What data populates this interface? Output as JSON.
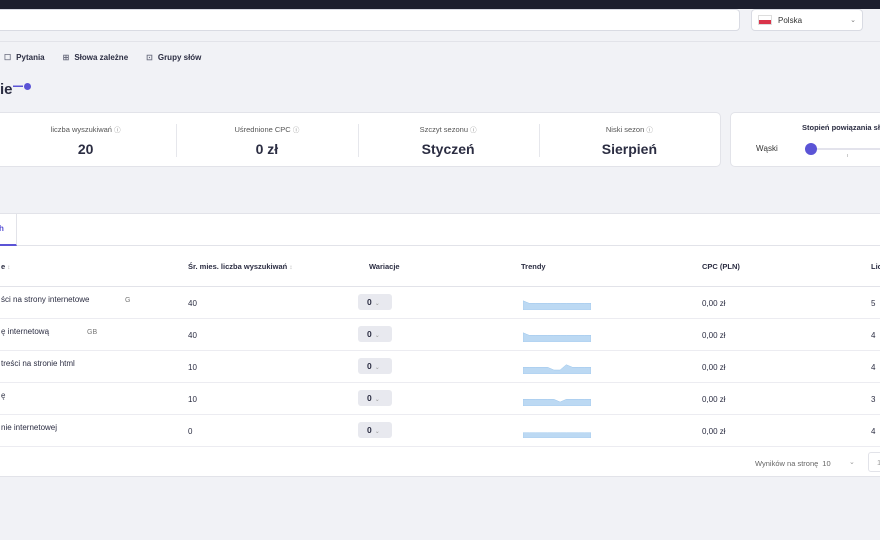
{
  "country": {
    "label": "Polska",
    "flag": "poland-flag"
  },
  "nav": [
    {
      "icon": "question-icon",
      "label": "Pytania"
    },
    {
      "icon": "keywords-icon",
      "label": "Słowa zależne"
    },
    {
      "icon": "groups-icon",
      "label": "Grupy słów"
    }
  ],
  "title": "ie",
  "stats": [
    {
      "label": "liczba wyszukiwań",
      "value": "20"
    },
    {
      "label": "Uśrednione CPC",
      "value": "0 zł"
    },
    {
      "label": "Szczyt sezonu",
      "value": "Styczeń"
    },
    {
      "label": "Niski sezon",
      "value": "Sierpień"
    }
  ],
  "relation": {
    "title": "Stopień powiązania sł",
    "narrow_label": "Wąski",
    "level": 0.0
  },
  "table": {
    "active_tab": "h",
    "columns": {
      "keyword": "e",
      "volume": "Śr. mies. liczba wyszukiwań",
      "variation": "Wariacje",
      "trends": "Trendy",
      "cpc": "CPC (PLN)",
      "last": "Lic"
    },
    "rows": [
      {
        "keyword": "ści na strony internetowe",
        "tag": "G",
        "volume": "40",
        "variation": "0",
        "trend": [
          4,
          2,
          2,
          2,
          2,
          2,
          2,
          2,
          2,
          2,
          2,
          2
        ],
        "cpc": "0,00 zł",
        "last": "5"
      },
      {
        "keyword": "ę internetową",
        "tag": "GB",
        "volume": "40",
        "variation": "0",
        "trend": [
          4,
          2,
          2,
          2,
          2,
          2,
          2,
          2,
          2,
          2,
          2,
          2
        ],
        "cpc": "0,00 zł",
        "last": "4"
      },
      {
        "keyword": "treści na stronie html",
        "tag": "",
        "volume": "10",
        "variation": "0",
        "trend": [
          2,
          2,
          2,
          2,
          2,
          0,
          0,
          4,
          2,
          2,
          2,
          2
        ],
        "cpc": "0,00 zł",
        "last": "4"
      },
      {
        "keyword": "ę",
        "tag": "",
        "volume": "10",
        "variation": "0",
        "trend": [
          2,
          2,
          2,
          2,
          2,
          2,
          0,
          2,
          2,
          2,
          2,
          2
        ],
        "cpc": "0,00 zł",
        "last": "3"
      },
      {
        "keyword": "nie internetowej",
        "tag": "",
        "volume": "0",
        "variation": "0",
        "trend": [
          1,
          1,
          1,
          1,
          1,
          1,
          1,
          1,
          1,
          1,
          1,
          1
        ],
        "cpc": "0,00 zł",
        "last": "4"
      }
    ],
    "pager": {
      "label": "Wyników na stronę",
      "per_page": "10",
      "page": "1"
    }
  }
}
